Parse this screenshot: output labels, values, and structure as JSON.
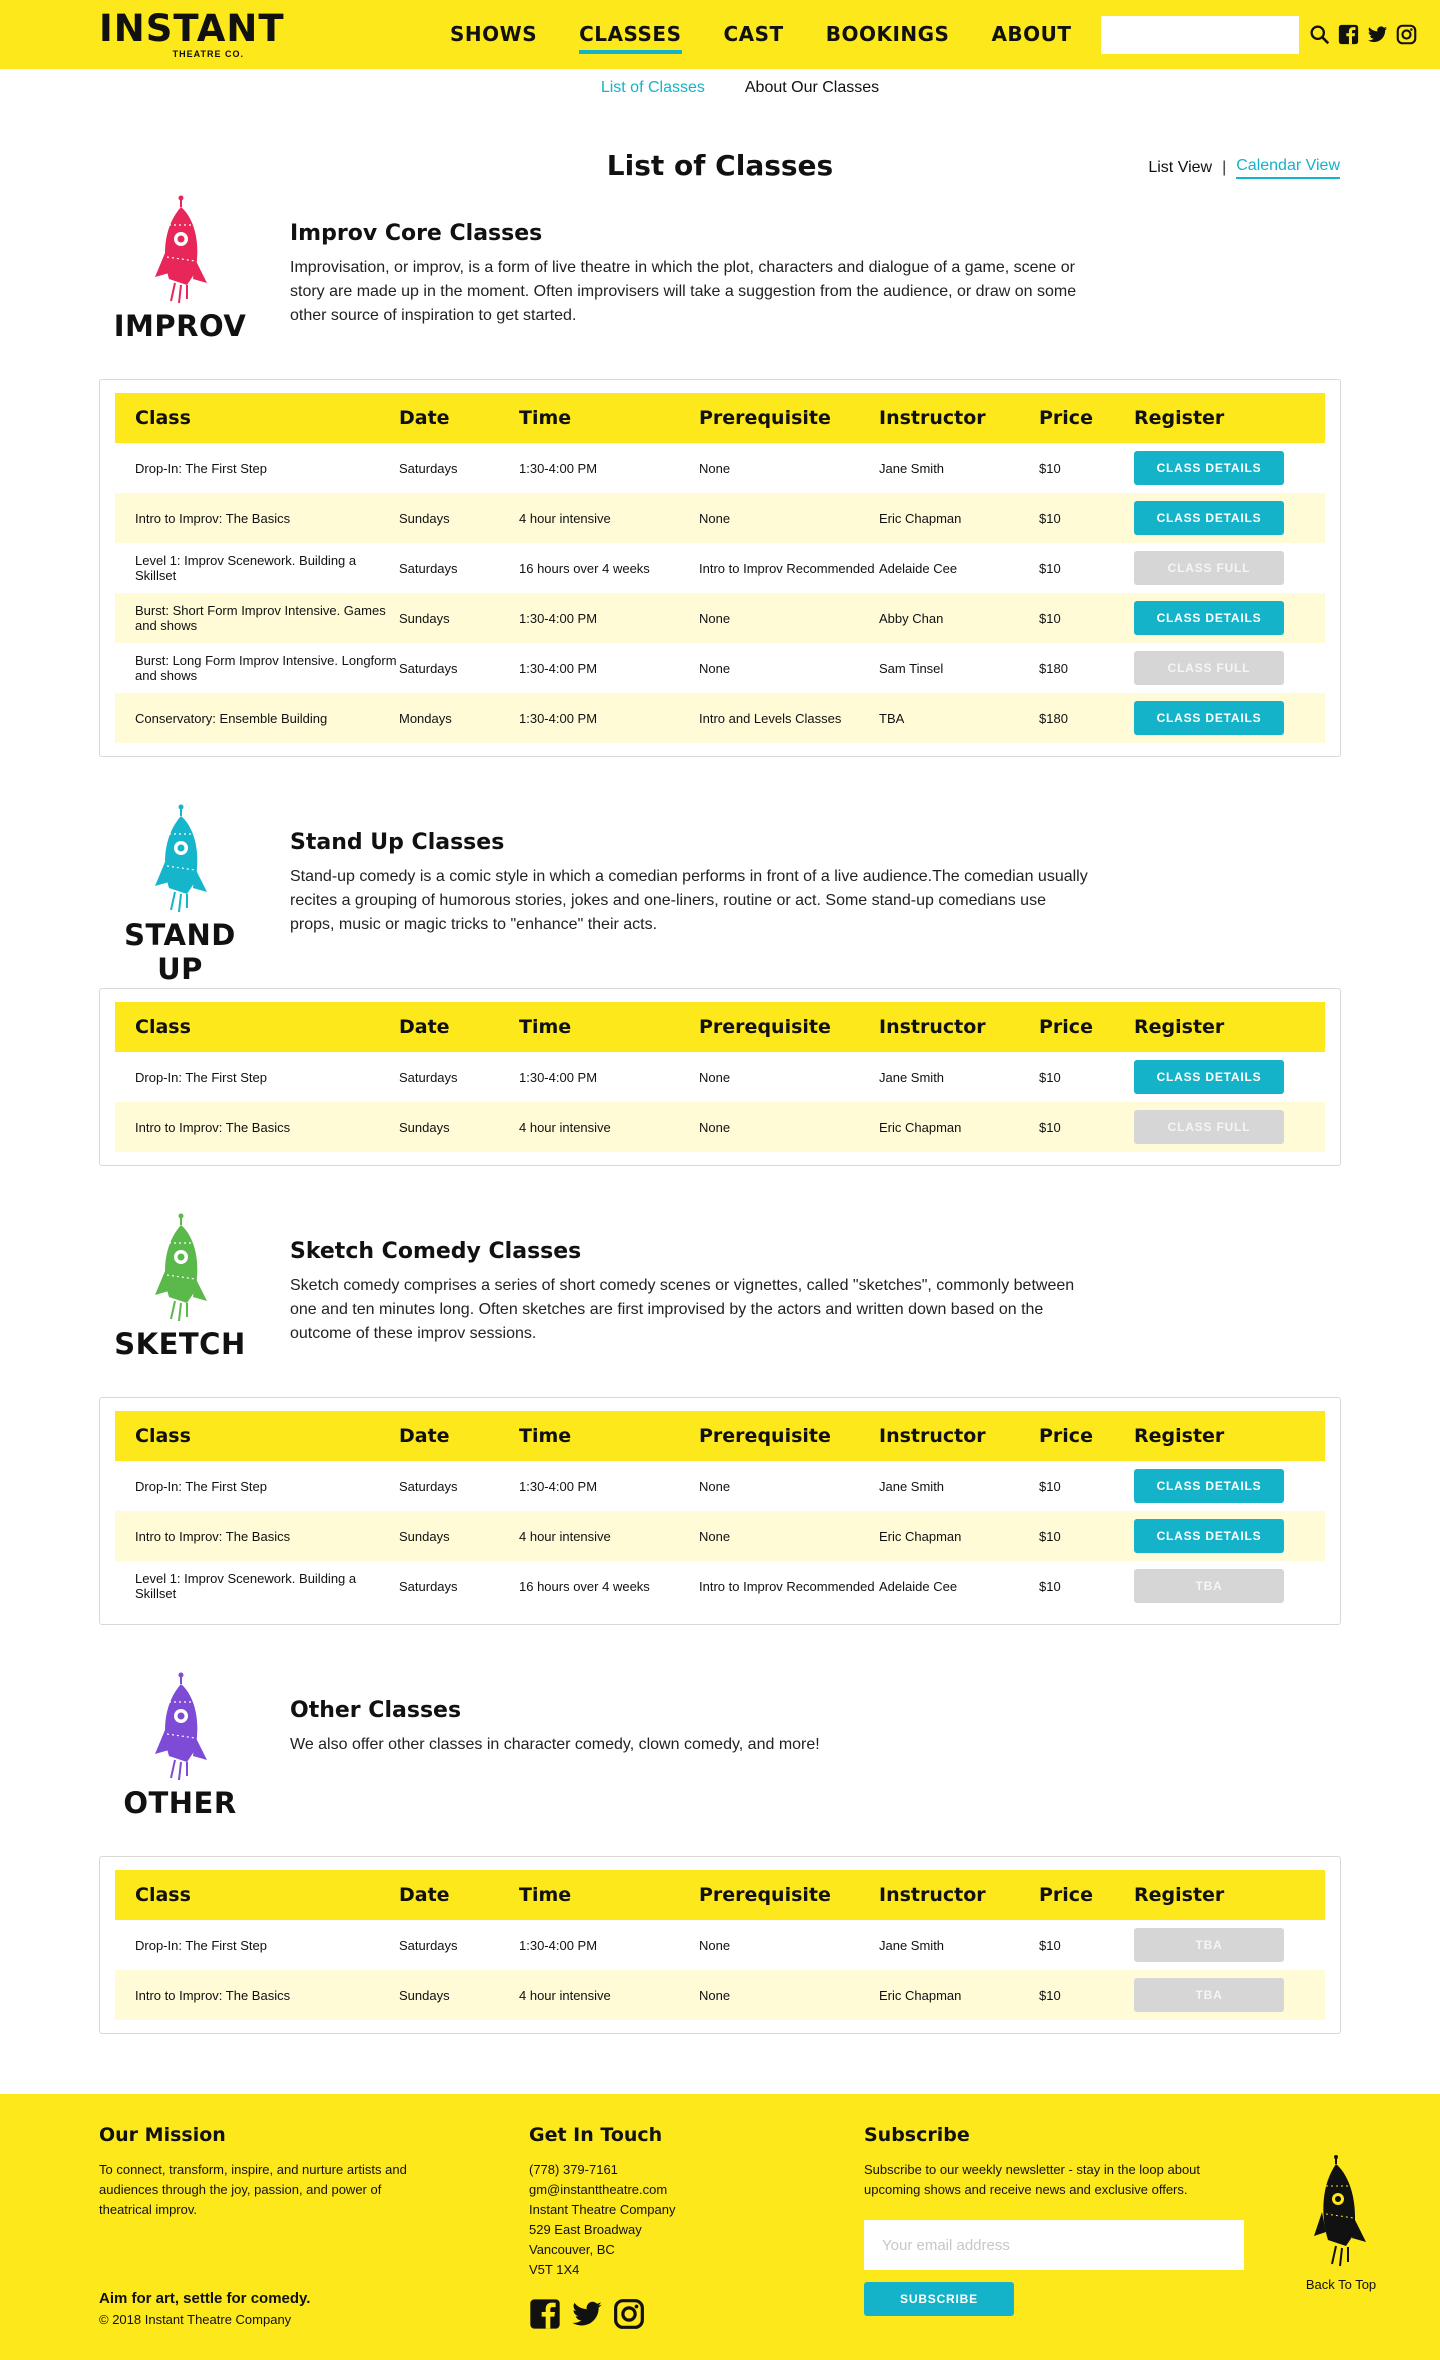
{
  "header": {
    "logo_word": "INSTANT",
    "logo_sub": "THEATRE CO.",
    "nav": [
      "SHOWS",
      "CLASSES",
      "CAST",
      "BOOKINGS",
      "ABOUT"
    ],
    "active_nav": "CLASSES",
    "search_placeholder": "",
    "icons": [
      "search-icon",
      "facebook-icon",
      "twitter-icon",
      "instagram-icon"
    ]
  },
  "subnav": {
    "list": "List of Classes",
    "about": "About Our Classes"
  },
  "page": {
    "title": "List of Classes",
    "list_view": "List View",
    "separator": "|",
    "calendar_view": "Calendar View"
  },
  "table_headers": [
    "Class",
    "Date",
    "Time",
    "Prerequisite",
    "Instructor",
    "Price",
    "Register"
  ],
  "sections": [
    {
      "label": "IMPROV",
      "color": "#e8265a",
      "title": "Improv Core Classes",
      "desc": "Improvisation, or improv, is a form of live theatre in which the plot, characters and dialogue of a game, scene or story are made up in the moment. Often improvisers will take a suggestion from the audience, or draw on some other source of inspiration to get started.",
      "rows": [
        {
          "cls": "Drop-In: The First Step",
          "date": "Saturdays",
          "time": "1:30-4:00 PM",
          "prereq": "None",
          "instructor": "Jane Smith",
          "price": "$10",
          "btn": "CLASS DETAILS",
          "enabled": true
        },
        {
          "cls": "Intro to Improv: The Basics",
          "date": "Sundays",
          "time": "4 hour intensive",
          "prereq": "None",
          "instructor": "Eric Chapman",
          "price": "$10",
          "btn": "CLASS DETAILS",
          "enabled": true
        },
        {
          "cls": "Level 1: Improv Scenework. Building a Skillset",
          "date": "Saturdays",
          "time": "16 hours over 4 weeks",
          "prereq": "Intro to Improv Recommended",
          "instructor": "Adelaide Cee",
          "price": "$10",
          "btn": "CLASS FULL",
          "enabled": false
        },
        {
          "cls": "Burst: Short Form Improv Intensive. Games and shows",
          "date": "Sundays",
          "time": "1:30-4:00 PM",
          "prereq": "None",
          "instructor": "Abby Chan",
          "price": "$10",
          "btn": "CLASS DETAILS",
          "enabled": true
        },
        {
          "cls": "Burst: Long Form Improv Intensive. Longform and shows",
          "date": "Saturdays",
          "time": "1:30-4:00 PM",
          "prereq": "None",
          "instructor": "Sam Tinsel",
          "price": "$180",
          "btn": "CLASS FULL",
          "enabled": false
        },
        {
          "cls": "Conservatory: Ensemble Building",
          "date": "Mondays",
          "time": "1:30-4:00 PM",
          "prereq": "Intro and Levels Classes",
          "instructor": "TBA",
          "price": "$180",
          "btn": "CLASS DETAILS",
          "enabled": true
        }
      ]
    },
    {
      "label": "STAND UP",
      "color": "#15b5cc",
      "title": "Stand Up Classes",
      "desc": "Stand-up comedy is a comic style in which a comedian performs in front of a live audience.The comedian usually recites a grouping of humorous stories, jokes and one-liners, routine or act. Some stand-up comedians use props, music or magic tricks to \"enhance\" their acts.",
      "rows": [
        {
          "cls": "Drop-In: The First Step",
          "date": "Saturdays",
          "time": "1:30-4:00 PM",
          "prereq": "None",
          "instructor": "Jane Smith",
          "price": "$10",
          "btn": "CLASS DETAILS",
          "enabled": true
        },
        {
          "cls": "Intro to Improv: The Basics",
          "date": "Sundays",
          "time": "4 hour intensive",
          "prereq": "None",
          "instructor": "Eric Chapman",
          "price": "$10",
          "btn": "CLASS FULL",
          "enabled": false
        }
      ]
    },
    {
      "label": "SKETCH",
      "color": "#5bb84a",
      "title": "Sketch Comedy Classes",
      "desc": "Sketch comedy comprises a series of short comedy scenes or vignettes, called \"sketches\", commonly between one and ten minutes long. Often sketches are first improvised by the actors and written down based on the outcome of these improv sessions.",
      "rows": [
        {
          "cls": "Drop-In: The First Step",
          "date": "Saturdays",
          "time": "1:30-4:00 PM",
          "prereq": "None",
          "instructor": "Jane Smith",
          "price": "$10",
          "btn": "CLASS DETAILS",
          "enabled": true
        },
        {
          "cls": "Intro to Improv: The Basics",
          "date": "Sundays",
          "time": "4 hour intensive",
          "prereq": "None",
          "instructor": "Eric Chapman",
          "price": "$10",
          "btn": "CLASS DETAILS",
          "enabled": true
        },
        {
          "cls": "Level 1: Improv Scenework. Building a Skillset",
          "date": "Saturdays",
          "time": "16 hours over 4 weeks",
          "prereq": "Intro to Improv Recommended",
          "instructor": "Adelaide Cee",
          "price": "$10",
          "btn": "TBA",
          "enabled": false
        }
      ]
    },
    {
      "label": "OTHER",
      "color": "#7d4bd6",
      "title": "Other Classes",
      "desc": "We also offer other classes in character comedy, clown comedy, and more!",
      "rows": [
        {
          "cls": "Drop-In: The First Step",
          "date": "Saturdays",
          "time": "1:30-4:00 PM",
          "prereq": "None",
          "instructor": "Jane Smith",
          "price": "$10",
          "btn": "TBA",
          "enabled": false
        },
        {
          "cls": "Intro to Improv: The Basics",
          "date": "Sundays",
          "time": "4 hour intensive",
          "prereq": "None",
          "instructor": "Eric Chapman",
          "price": "$10",
          "btn": "TBA",
          "enabled": false
        }
      ]
    }
  ],
  "footer": {
    "mission_title": "Our Mission",
    "mission_text": "To connect, transform, inspire, and nurture artists and audiences through the joy, passion, and power of theatrical improv.",
    "contact_title": "Get In Touch",
    "contact_lines": [
      "(778) 379-7161",
      "gm@instanttheatre.com",
      "Instant Theatre Company",
      "529 East Broadway",
      "Vancouver, BC",
      "V5T 1X4"
    ],
    "subscribe_title": "Subscribe",
    "subscribe_text": "Subscribe to our weekly newsletter - stay in the loop about upcoming shows and receive news and exclusive offers.",
    "email_placeholder": "Your email address",
    "subscribe_btn": "SUBSCRIBE",
    "tagline": "Aim for art, settle for comedy.",
    "copyright": "© 2018 Instant Theatre Company",
    "back_to_top": "Back To Top",
    "social": [
      "facebook-icon",
      "twitter-icon",
      "instagram-icon"
    ]
  }
}
